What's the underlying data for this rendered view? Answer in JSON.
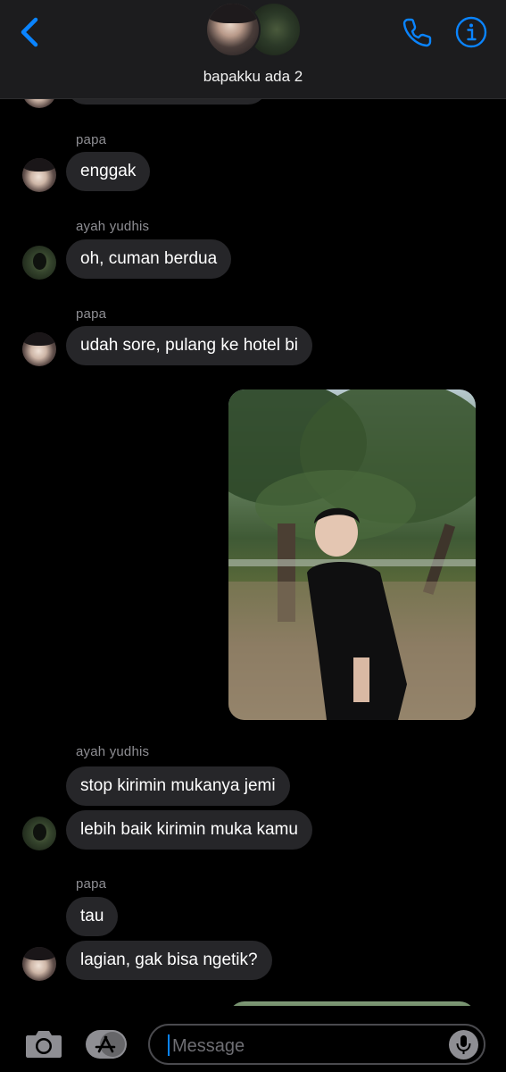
{
  "header": {
    "title": "bapakku ada 2",
    "back_icon": "chevron-left-icon",
    "call_icon": "phone-icon",
    "info_icon": "info-icon",
    "accent_color": "#0a84ff"
  },
  "thread": {
    "messages": [
      {
        "sender": "papa",
        "text": "enggak"
      },
      {
        "sender": "ayah yudhis",
        "text": "oh, cuman berdua"
      },
      {
        "sender": "papa",
        "text": "udah sore, pulang ke hotel bi"
      },
      {
        "sender": "me",
        "type": "photo"
      },
      {
        "sender": "ayah yudhis",
        "texts": [
          "stop kirimin mukanya jemi",
          "lebih baik kirimin muka kamu"
        ]
      },
      {
        "sender": "papa",
        "texts": [
          "tau",
          "lagian, gak bisa ngetik?"
        ]
      },
      {
        "sender": "me",
        "type": "photo"
      }
    ]
  },
  "compose": {
    "placeholder": "Message",
    "camera_icon": "camera-icon",
    "appstore_icon": "app-store-icon",
    "mic_icon": "microphone-icon"
  },
  "colors": {
    "background": "#000000",
    "header_bg": "#1c1c1e",
    "bubble_received": "#262629",
    "sender_name": "#8e8e93"
  }
}
